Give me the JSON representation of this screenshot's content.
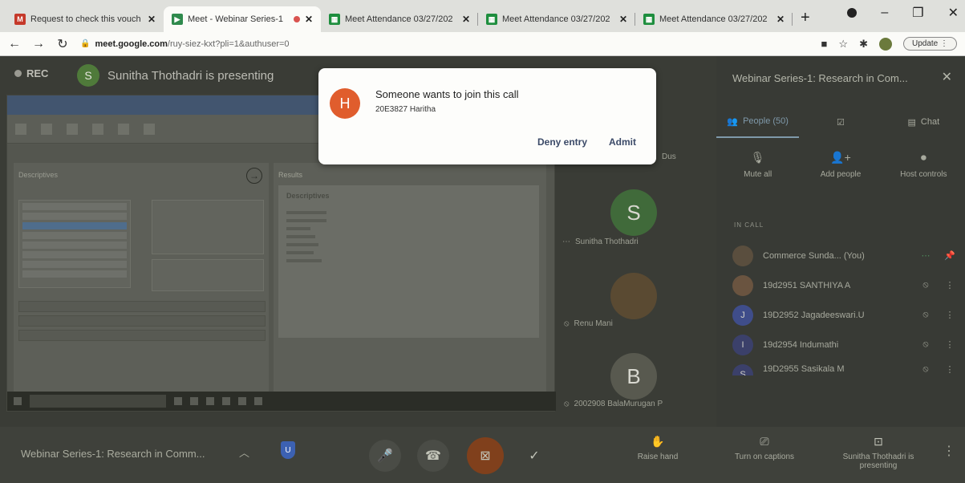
{
  "browser": {
    "tabs": [
      {
        "title": "Request to check this vouch",
        "icon": "gmail-icon",
        "active": false
      },
      {
        "title": "Meet - Webinar Series-1",
        "icon": "meet-icon",
        "active": true
      },
      {
        "title": "Meet Attendance 03/27/202",
        "icon": "sheets-icon",
        "active": false
      },
      {
        "title": "Meet Attendance 03/27/202",
        "icon": "sheets-icon",
        "active": false
      },
      {
        "title": "Meet Attendance 03/27/202",
        "icon": "sheets-icon",
        "active": false
      }
    ],
    "url_host": "meet.google.com",
    "url_path": "/ruy-siez-kxt?pli=1&authuser=0",
    "update_label": "Update"
  },
  "stage": {
    "rec_label": "REC",
    "presenter_initial": "S",
    "presenter_text": "Sunitha Thothadri is presenting",
    "shared_screen": {
      "left_pane_title": "Descriptives",
      "right_pane_title": "Results",
      "right_inner_title": "Descriptives"
    },
    "tiles": [
      {
        "initial": "",
        "name": "Dus"
      },
      {
        "initial": "S",
        "name": "Sunitha Thothadri"
      },
      {
        "initial": "",
        "name": "Renu Mani"
      },
      {
        "initial": "B",
        "name": "2002908 BalaMurugan P"
      }
    ]
  },
  "dialog": {
    "avatar_initial": "H",
    "message": "Someone wants to join this call",
    "requester": "20E3827 Haritha",
    "deny_label": "Deny entry",
    "admit_label": "Admit"
  },
  "side_panel": {
    "title": "Webinar Series-1: Research in Com...",
    "tabs": [
      {
        "label": "People (50)",
        "icon": "people-icon"
      },
      {
        "label": "",
        "icon": "activities-icon"
      },
      {
        "label": "Chat",
        "icon": "chat-icon"
      }
    ],
    "actions": [
      {
        "label": "Mute all",
        "icon": "mic-off-icon"
      },
      {
        "label": "Add people",
        "icon": "add-person-icon"
      },
      {
        "label": "Host controls",
        "icon": "toggle-icon"
      }
    ],
    "section_label": "IN CALL",
    "participants": [
      {
        "name": "Commerce Sunda... (You)",
        "initial": "",
        "status": "speaking",
        "action": "pin-icon"
      },
      {
        "name": "19d2951 SANTHIYA A",
        "initial": "",
        "status": "muted",
        "action": "more-vert-icon"
      },
      {
        "name": "19D2952 Jagadeeswari.U",
        "initial": "J",
        "status": "muted",
        "action": "more-vert-icon"
      },
      {
        "name": "19d2954 Indumathi",
        "initial": "I",
        "status": "muted",
        "action": "more-vert-icon"
      },
      {
        "name": "19D2955 Sasikala M",
        "initial": "S",
        "status": "muted",
        "action": "more-vert-icon"
      }
    ]
  },
  "bottom_bar": {
    "meeting_title": "Webinar Series-1: Research in Comm...",
    "raise_hand_label": "Raise hand",
    "captions_label": "Turn on captions",
    "presenting_label": "Sunitha Thothadri is presenting"
  },
  "colors": {
    "dialog_avatar": "#e05d2d",
    "accent": "#7f99aa",
    "camera_off": "#80401c"
  }
}
